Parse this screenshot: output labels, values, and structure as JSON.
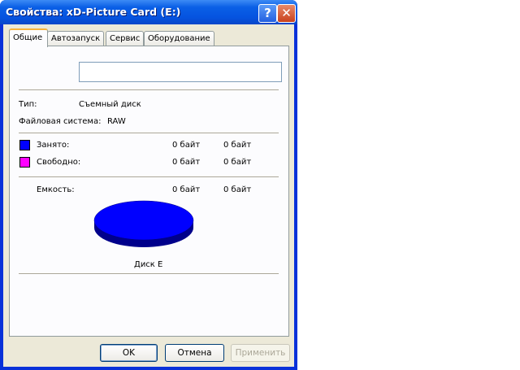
{
  "window": {
    "title": "Свойства: xD-Picture Card (E:)",
    "help": "?",
    "close": "✕"
  },
  "tabs": [
    {
      "label": "Общие"
    },
    {
      "label": "Автозапуск"
    },
    {
      "label": "Сервис"
    },
    {
      "label": "Оборудование"
    }
  ],
  "general": {
    "name_value": "",
    "type_label": "Тип:",
    "type_value": "Съемный диск",
    "fs_label": "Файловая система:",
    "fs_value": "RAW",
    "used_label": "Занято:",
    "used_bytes": "0 байт",
    "used_size": "0 байт",
    "free_label": "Свободно:",
    "free_bytes": "0 байт",
    "free_size": "0 байт",
    "capacity_label": "Емкость:",
    "capacity_bytes": "0 байт",
    "capacity_size": "0 байт",
    "disk_label": "Диск E",
    "colors": {
      "used": "#0000ff",
      "free": "#ff00ff"
    }
  },
  "buttons": {
    "ok": "OK",
    "cancel": "Отмена",
    "apply": "Применить"
  }
}
